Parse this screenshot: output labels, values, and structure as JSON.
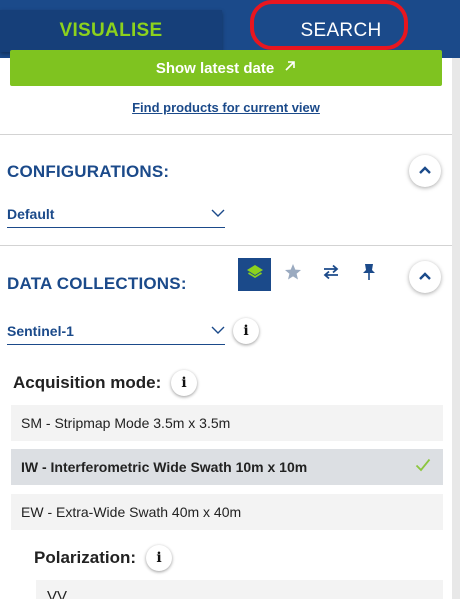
{
  "tabs": {
    "visualise": "VISUALISE",
    "search": "SEARCH"
  },
  "actions": {
    "show_latest_label": "Show latest date",
    "show_latest_icon": "arrow-up-right-icon",
    "find_products_label": "Find products for current view"
  },
  "configurations": {
    "title": "CONFIGURATIONS:",
    "selected": "Default"
  },
  "data_collections": {
    "title": "DATA COLLECTIONS:",
    "toolbar_icons": [
      "layers-icon",
      "star-icon",
      "swap-icon",
      "pin-icon"
    ],
    "selected": "Sentinel-1"
  },
  "acquisition_mode": {
    "label": "Acquisition mode:",
    "options": [
      {
        "label": "SM - Stripmap Mode 3.5m x 3.5m",
        "selected": false
      },
      {
        "label": "IW - Interferometric Wide Swath 10m x 10m",
        "selected": true
      },
      {
        "label": "EW - Extra-Wide Swath 40m x 40m",
        "selected": false
      }
    ]
  },
  "polarization": {
    "label": "Polarization:",
    "options": [
      "VV"
    ]
  },
  "colors": {
    "primary": "#1b4a8a",
    "accent_green": "#7fc320",
    "annotation_red": "#e8161f"
  }
}
